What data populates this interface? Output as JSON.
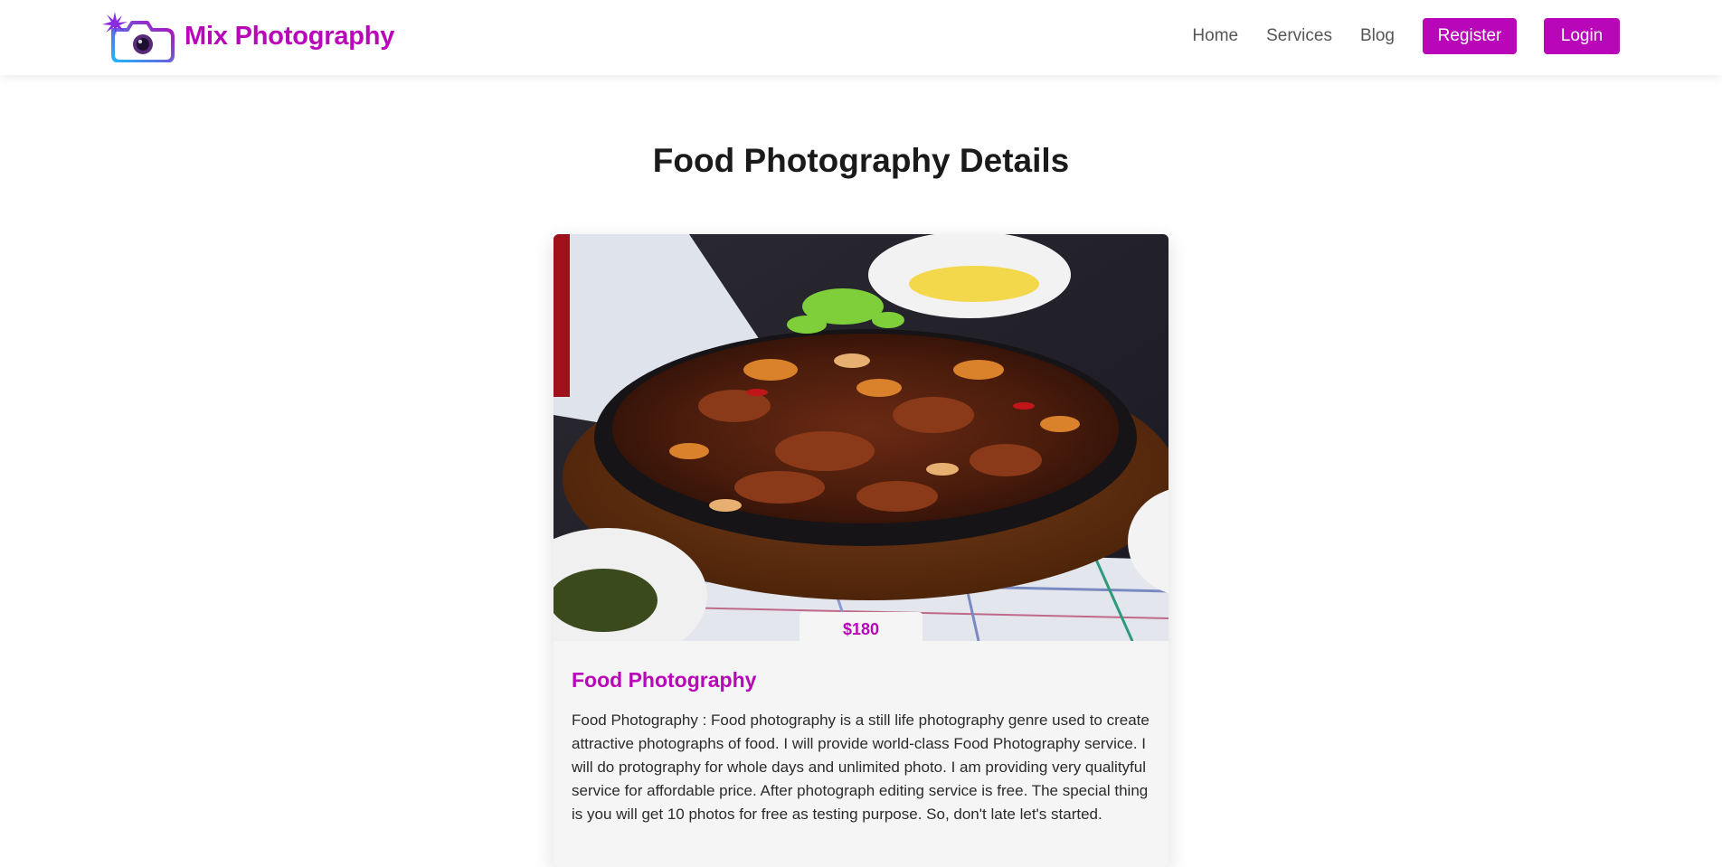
{
  "brand": {
    "name": "Mix Photography",
    "logo_icon": "camera-logo-icon",
    "color": "#b806b8"
  },
  "nav": {
    "links": [
      "Home",
      "Services",
      "Blog"
    ],
    "register_label": "Register",
    "login_label": "Login"
  },
  "page": {
    "title": "Food Photography Details"
  },
  "service": {
    "image_alt": "food-dish-photo",
    "price": "$180",
    "title": "Food Photography",
    "description": "Food Photography : Food photography is a still life photography genre used to create attractive photographs of food. I will provide world-class Food Photography service. I will do protography for whole days and unlimited photo. I am providing very qualityful service for affordable price. After photograph editing service is free. The special thing is you will get 10 photos for free as testing purpose. So, don't late let's started."
  },
  "colors": {
    "accent": "#b806b8",
    "nav_text": "#565656",
    "card_bg": "#f5f5f5"
  }
}
